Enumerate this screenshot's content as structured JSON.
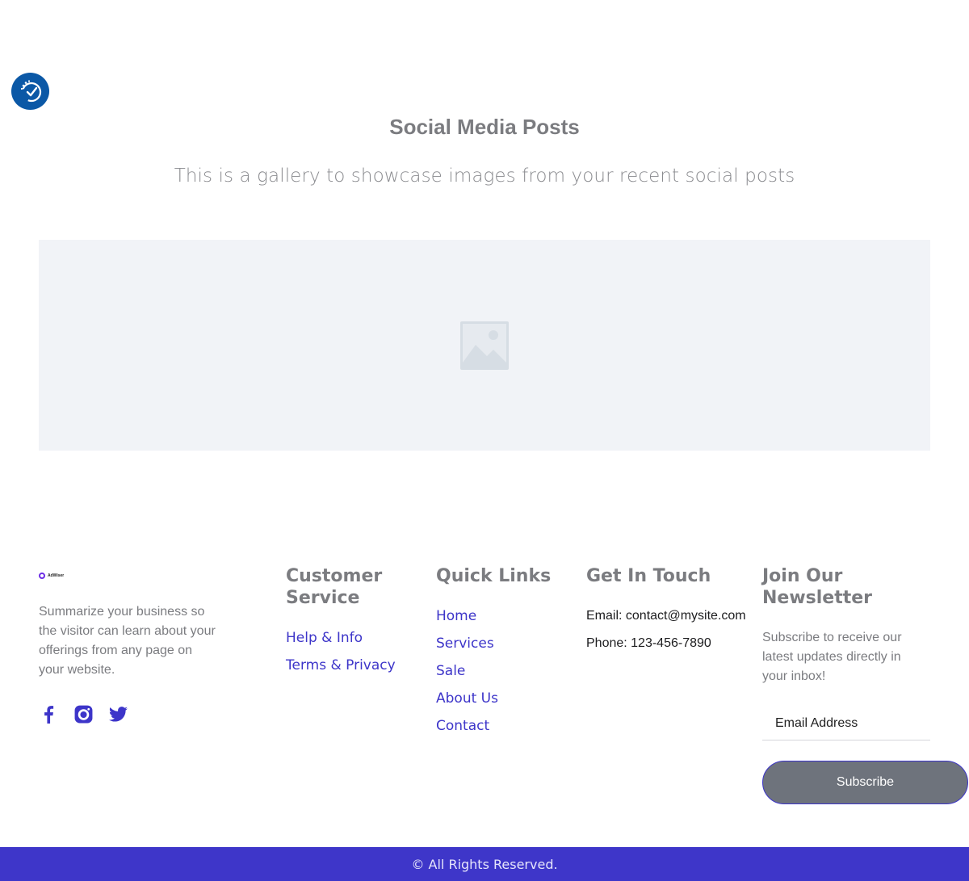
{
  "accessibility": {
    "icon": "accessibility-check-icon",
    "color": "#0b58a6"
  },
  "hero": {
    "title": "Social Media Posts",
    "subtitle": "This is a gallery to showcase images from your recent social posts"
  },
  "gallery": {
    "placeholder_icon": "image-placeholder-icon"
  },
  "footer": {
    "brand": {
      "logo_text": "AdWiser",
      "description": "Summarize your business so the visitor can learn about your offerings from any page on your website.",
      "socials": [
        "facebook-icon",
        "instagram-icon",
        "twitter-icon"
      ]
    },
    "customer_service": {
      "title": "Customer Service",
      "links": [
        "Help & Info",
        "Terms & Privacy"
      ]
    },
    "quick_links": {
      "title": "Quick Links",
      "links": [
        "Home",
        "Services",
        "Sale",
        "About Us",
        "Contact"
      ]
    },
    "get_in_touch": {
      "title": "Get In Touch",
      "email": "Email: contact@mysite.com",
      "phone": "Phone: 123-456-7890"
    },
    "newsletter": {
      "title": "Join Our Newsletter",
      "text": "Subscribe to receive our latest updates directly in your inbox!",
      "email_placeholder": "Email Address",
      "button_label": "Subscribe"
    }
  },
  "bottom_bar": {
    "copyright": "© All Rights Reserved.",
    "color": "#3e36c9"
  },
  "colors": {
    "accent": "#3d35c9",
    "heading": "#7b7c80",
    "button": "#6e737c"
  }
}
